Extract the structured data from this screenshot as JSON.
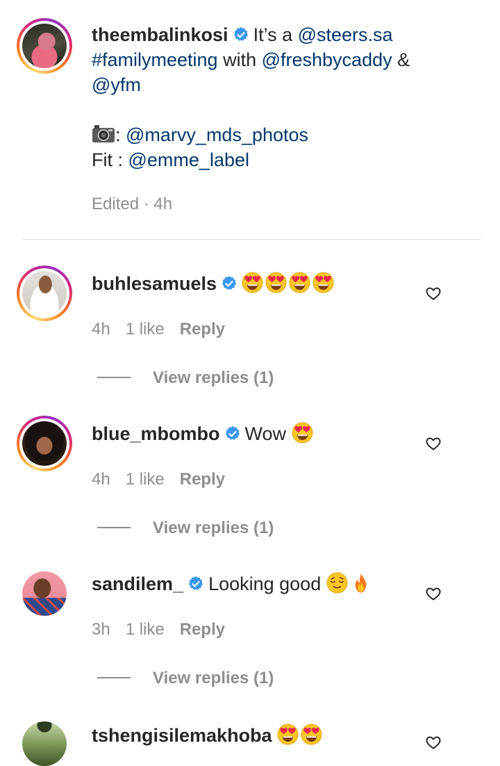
{
  "caption": {
    "username": "theembalinkosi",
    "lines": {
      "l1_text": "It’s a ",
      "l1_mention": "@steers.sa",
      "l2_hashtag": "#familymeeting",
      "l2_text": " with ",
      "l2_mention": "@freshbycaddy",
      "l2_amp": " &",
      "l3_mention": "@yfm",
      "l4_prefix": ": ",
      "l4_mention": "@marvy_mds_photos",
      "l5_prefix": "Fit : ",
      "l5_mention": "@emme_label"
    },
    "camera_icon": "camera-emoji",
    "meta": "Edited · 4h"
  },
  "comments": [
    {
      "username": "buhlesamuels",
      "text": "",
      "emojis": [
        "heart-eyes",
        "heart-eyes",
        "heart-eyes",
        "heart-eyes"
      ],
      "time": "4h",
      "likes": "1 like",
      "reply": "Reply",
      "view_replies": "View replies (1)",
      "story_ring": true
    },
    {
      "username": "blue_mbombo",
      "text": "Wow",
      "emojis": [
        "heart-eyes"
      ],
      "time": "4h",
      "likes": "1 like",
      "reply": "Reply",
      "view_replies": "View replies (1)",
      "story_ring": true
    },
    {
      "username": "sandilem_",
      "text": "Looking good",
      "emojis": [
        "relieved-face",
        "fire"
      ],
      "time": "3h",
      "likes": "1 like",
      "reply": "Reply",
      "view_replies": "View replies (1)",
      "story_ring": false
    },
    {
      "username": "tshengisilemakhoba",
      "text": "",
      "emojis": [
        "heart-eyes",
        "heart-eyes"
      ],
      "story_ring": false
    }
  ],
  "colors": {
    "text": "#262626",
    "link": "#00376b",
    "secondary": "#8e8e8e",
    "verified": "#3897f0",
    "divider": "#dbdbdb"
  }
}
